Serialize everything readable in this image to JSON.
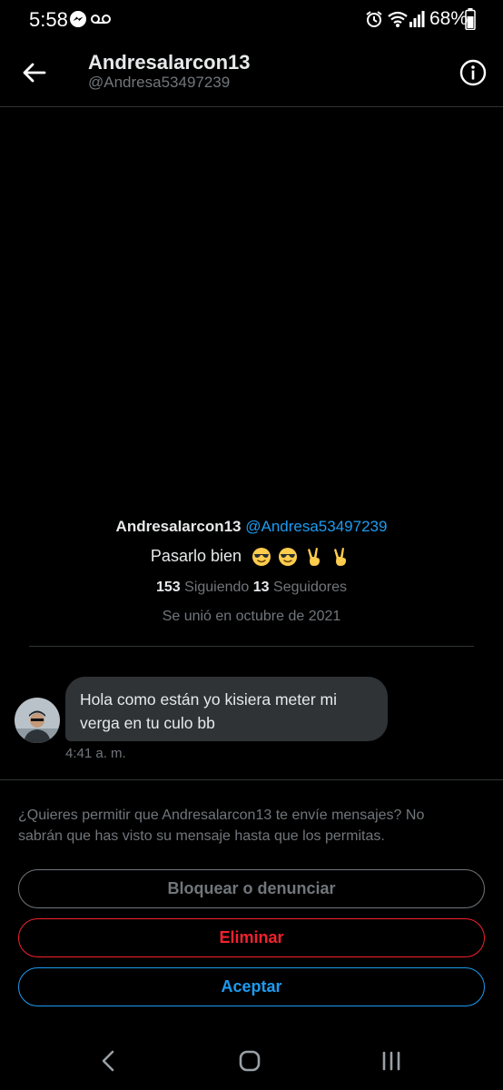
{
  "status_bar": {
    "time": "5:58",
    "battery": "68%",
    "icons": [
      "messenger-icon",
      "voicemail-icon",
      "alarm-icon",
      "wifi-icon",
      "signal-icon",
      "battery-icon"
    ]
  },
  "header": {
    "name": "Andresalarcon13",
    "handle": "@Andresa53497239",
    "back_icon": "arrow-left",
    "info_icon": "info-circle"
  },
  "profile": {
    "name": "Andresalarcon13",
    "handle": "@Andresa53497239",
    "bio": "Pasarlo bien",
    "bio_emoji": [
      "😎",
      "😎",
      "✌",
      "✌"
    ],
    "following_count": "153",
    "following_label": "Siguiendo",
    "followers_count": "13",
    "followers_label": "Seguidores",
    "joined": "Se unió en octubre de 2021"
  },
  "message": {
    "text": "Hola como están yo kisiera meter mi verga en tu culo bb",
    "time": "4:41 a. m."
  },
  "request": {
    "prompt": "¿Quieres permitir que Andresalarcon13 te envíe mensajes? No sabrán que has visto su mensaje hasta que los permitas.",
    "block_label": "Bloquear o denunciar",
    "delete_label": "Eliminar",
    "accept_label": "Aceptar"
  },
  "colors": {
    "background": "#000000",
    "accent": "#1d9bf0",
    "danger": "#f4212e",
    "muted": "#71767b",
    "bubble": "#2f3336"
  }
}
